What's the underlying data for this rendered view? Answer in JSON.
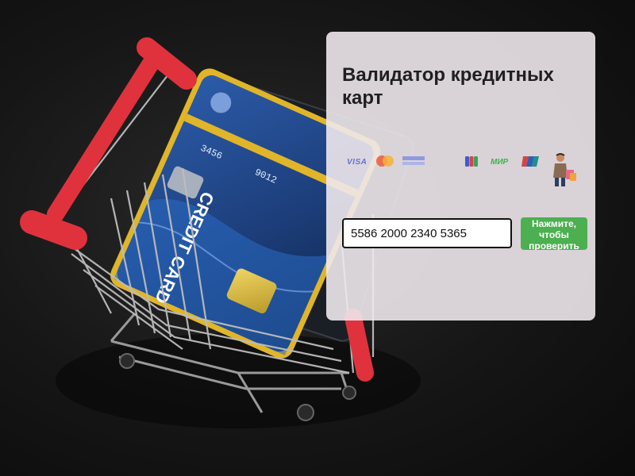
{
  "app": {
    "title": "Валидатор кредитных карт"
  },
  "payment_logos": [
    {
      "name": "visa",
      "label": "VISA",
      "color": "#6a6fd0"
    },
    {
      "name": "mastercard",
      "label": "",
      "colors": [
        "#eb5a3a",
        "#f7b23b"
      ]
    },
    {
      "name": "amex",
      "label": "",
      "color": "#7c8be0"
    },
    {
      "name": "jcb",
      "label": "",
      "colors": [
        "#3b5ec9",
        "#d94150",
        "#38a35b"
      ]
    },
    {
      "name": "mir",
      "label": "МИР",
      "color": "#3fb34f"
    },
    {
      "name": "unionpay",
      "label": "",
      "colors": [
        "#d64545",
        "#2e5fb5",
        "#1f8f8f"
      ]
    }
  ],
  "form": {
    "card_number": "5586 2000 2340 5365",
    "check_button_label": "Нажмите, чтобы проверить"
  },
  "colors": {
    "panel_bg": "#eee8ec",
    "button": "#4caf50",
    "cart_handle": "#e0323c"
  }
}
